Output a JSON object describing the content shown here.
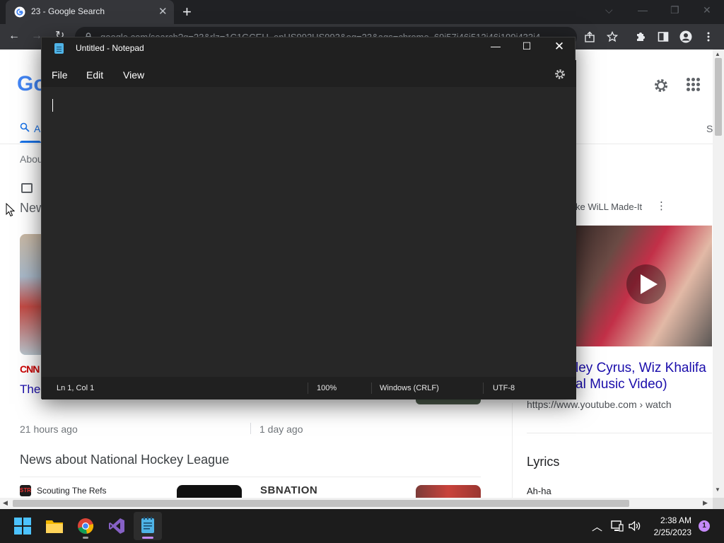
{
  "browser": {
    "tab": {
      "title": "23 - Google Search",
      "close_glyph": "✕"
    },
    "new_tab_glyph": "+",
    "window_controls": {
      "dropdown": "⌵",
      "minimize": "—",
      "restore": "❐",
      "close": "✕"
    },
    "nav": {
      "back": "←",
      "forward": "→",
      "reload": "↻"
    },
    "omnibox": {
      "url": "google.com/search?q=23&rlz=1C1GCEU_enUS992US992&oq=23&aqs=chrome..69i57j46i512j46i199i433i4"
    },
    "toolbar_icons": [
      "share-icon",
      "star-icon",
      "extensions-icon",
      "sidepanel-icon",
      "profile-icon",
      "kebab-menu-icon"
    ]
  },
  "google": {
    "logo_partial": "Go",
    "tab_all_partial": "A",
    "tab_s_partial": "S",
    "about_partial": "Abou",
    "news_heading_partial": "New",
    "cnn_logo": "CNN",
    "news_title_partial": "The",
    "time_1": "21 hours ago",
    "time_2": "1 day ago",
    "nhl_heading": "News about National Hockey League",
    "nhl_source_1": "Scouting The Refs",
    "nhl_source_2_logo": "SBNATION",
    "video_label_partial": "ke WiLL Made-It",
    "video_more": "⋮",
    "video_title_line1": "ley Cyrus, Wiz Khalifa",
    "video_title_line2": "al Music Video)",
    "video_url": "https://www.youtube.com › watch",
    "lyrics_heading": "Lyrics",
    "lyrics_line": "Ah-ha"
  },
  "notepad": {
    "title": "Untitled - Notepad",
    "controls": {
      "minimize": "—",
      "maximize": "☐",
      "close": "✕"
    },
    "menu": [
      "File",
      "Edit",
      "View"
    ],
    "status": {
      "position": "Ln 1, Col 1",
      "zoom": "100%",
      "line_ending": "Windows (CRLF)",
      "encoding": "UTF-8"
    }
  },
  "taskbar": {
    "apps": [
      "windows-start-icon",
      "file-explorer-icon",
      "chrome-icon",
      "visual-studio-icon",
      "notepad-icon"
    ],
    "tray": {
      "chevron": "︿"
    },
    "clock": {
      "time": "2:38 AM",
      "date": "2/25/2023"
    },
    "notification_count": "1"
  },
  "colors": {
    "chrome_dark": "#202124",
    "notepad_bg": "#272727",
    "taskbar_bg": "#1c1c1c",
    "google_link": "#1a0dab",
    "accent_purple": "#c58af9"
  }
}
